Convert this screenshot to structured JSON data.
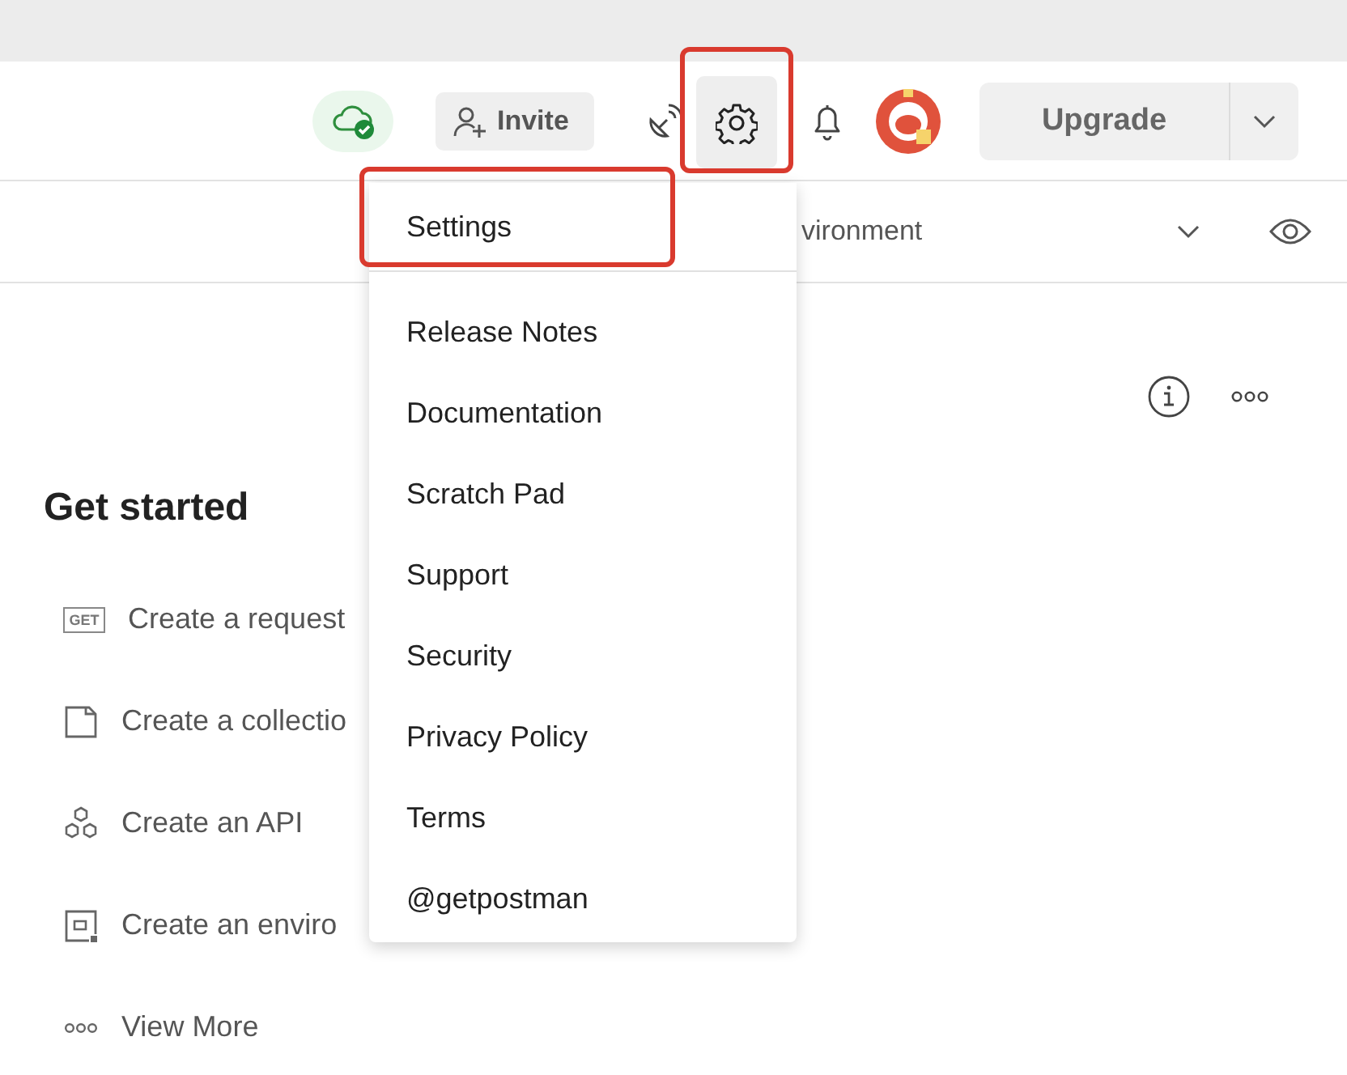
{
  "header": {
    "invite_button": "Invite",
    "settings_button": {
      "highlighted": true
    },
    "upgrade_button": "Upgrade"
  },
  "environment_bar": {
    "selector_text": "vironment"
  },
  "workspace": {
    "title": "Get started",
    "actions": [
      {
        "kind": "request",
        "icon_text": "GET",
        "label": "Create a request"
      },
      {
        "kind": "collection",
        "label": "Create a collectio"
      },
      {
        "kind": "api",
        "label": "Create an API"
      },
      {
        "kind": "environment",
        "label": "Create an enviro"
      },
      {
        "kind": "more",
        "label": "View More"
      }
    ]
  },
  "settings_menu": {
    "groups": [
      [
        {
          "label": "Settings",
          "highlighted": true
        }
      ],
      [
        {
          "label": "Release Notes",
          "highlighted": false
        },
        {
          "label": "Documentation",
          "highlighted": false
        },
        {
          "label": "Scratch Pad",
          "highlighted": false
        },
        {
          "label": "Support",
          "highlighted": false
        },
        {
          "label": "Security",
          "highlighted": false
        },
        {
          "label": "Privacy Policy",
          "highlighted": false
        },
        {
          "label": "Terms",
          "highlighted": false
        },
        {
          "label": "@getpostman",
          "highlighted": false
        }
      ]
    ]
  }
}
